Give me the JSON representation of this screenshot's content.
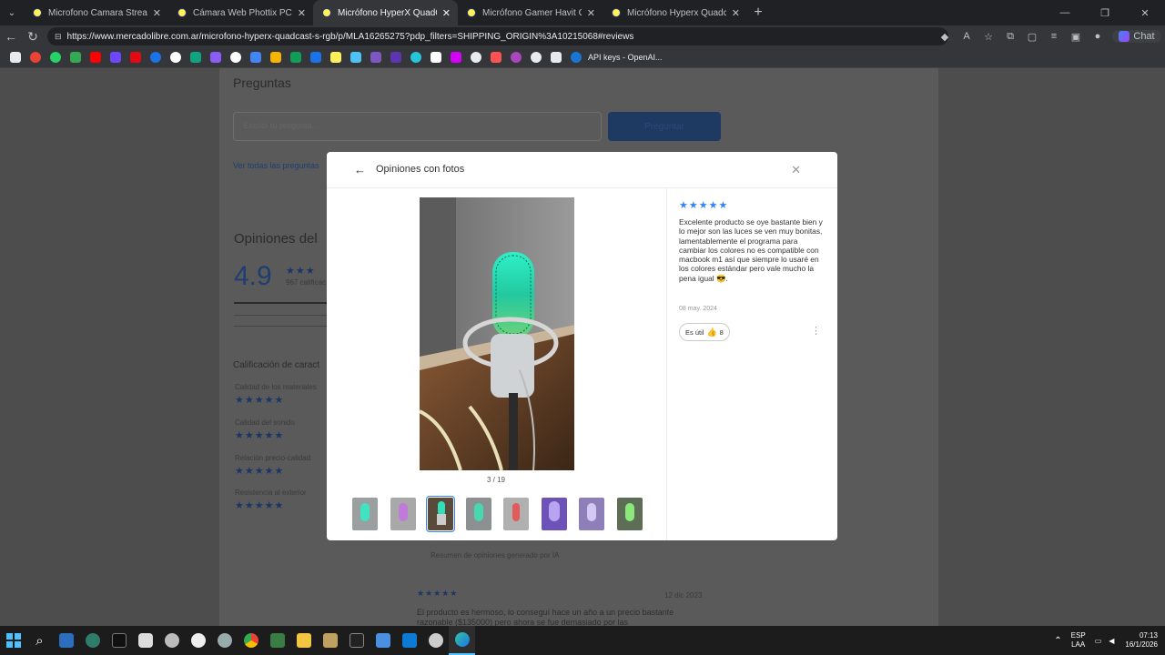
{
  "browser": {
    "tabs": [
      {
        "title": "Microfono Camara Streaming | Me",
        "active": false
      },
      {
        "title": "Cámara Web Phottix PC-20 FHD Fu",
        "active": false
      },
      {
        "title": "Micrófono HyperX QuadCast S RG",
        "active": true
      },
      {
        "title": "Micrófono Gamer Havit Gk50 Pro",
        "active": false
      },
      {
        "title": "Micrófono Hyperx Quadcast 2 Usb",
        "active": false
      }
    ],
    "url": "https://www.mercadolibre.com.ar/microfono-hyperx-quadcast-s-rgb/p/MLA16265275?pdp_filters=SHIPPING_ORIGIN%3A10215068#reviews",
    "chat_label": "Chat",
    "bookmark_label": "API keys - OpenAI..."
  },
  "background": {
    "preguntas_title": "Preguntas",
    "question_placeholder": "Escribí tu pregunta...",
    "ask_button": "Preguntar",
    "see_all_questions": "Ver todas las preguntas",
    "opinions_title": "Opiniones del",
    "rating_value": "4.9",
    "rating_count": "967 calificac",
    "characteristics_title": "Calificación de caract",
    "characteristics": [
      "Calidad de los materiales",
      "Calidad del sonido",
      "Relación precio-calidad",
      "Resistencia al exterior"
    ],
    "ai_summary": "Resumen de opiniones generado por IA",
    "bottom_review_date": "12 dic 2023",
    "bottom_review_text": "El producto es hermoso, lo conseguí hace un año a un precio bastante razonable ($135000) pero ahora se fue demasiado por las"
  },
  "modal": {
    "title": "Opiniones con fotos",
    "counter": "3 / 19",
    "selected_thumb": 3,
    "review": {
      "stars": "★★★★★",
      "text": "Excelente producto se oye bastante bien y lo mejor son las luces se ven muy bonitas, lamentablemente el programa para cambiar los colores no es compatible con macbook m1 así que siempre lo usaré en los colores estándar pero vale mucho la pena igual 😎.",
      "date": "08 may. 2024",
      "useful_label": "Es útil",
      "useful_count": "8"
    }
  },
  "taskbar": {
    "language": "ESP",
    "layout": "LAA",
    "time": "07:13",
    "date": "16/1/2026"
  }
}
